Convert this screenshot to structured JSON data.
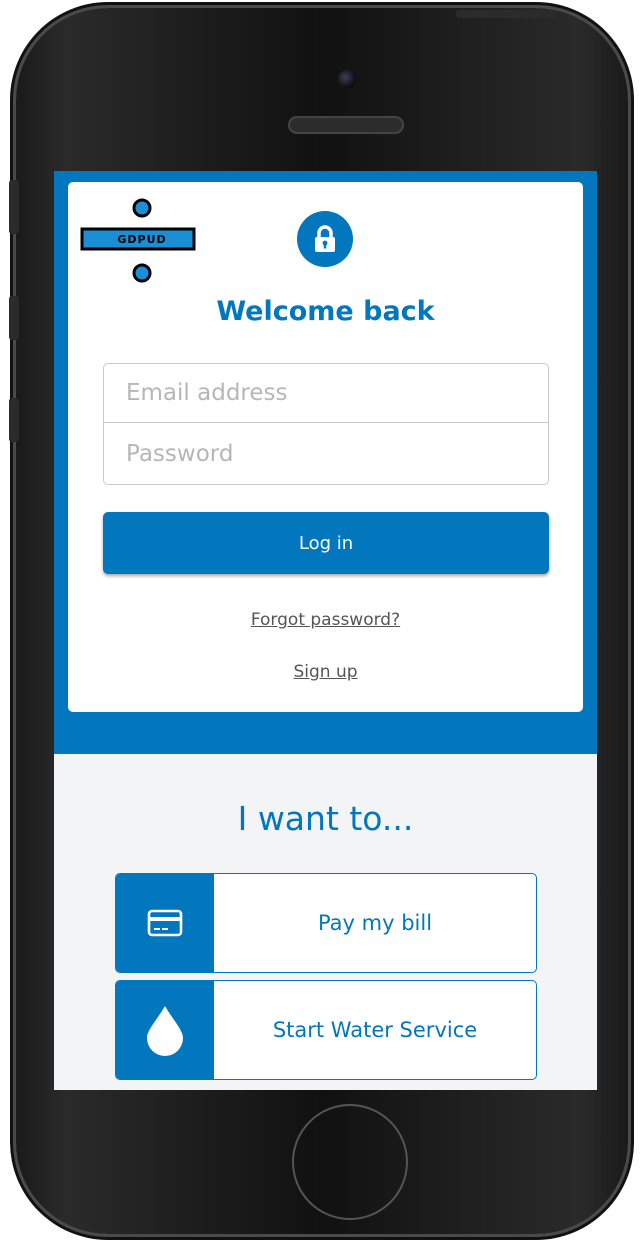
{
  "brand": {
    "logo_text": "GDPUD",
    "accent": "#0277bd"
  },
  "login": {
    "title": "Welcome back",
    "email_placeholder": "Email address",
    "password_placeholder": "Password",
    "login_label": "Log in",
    "forgot_label": "Forgot password?",
    "signup_label": "Sign up",
    "lock_icon": "lock-icon"
  },
  "actions": {
    "heading": "I want to...",
    "items": [
      {
        "label": "Pay my bill",
        "icon": "credit-card-icon"
      },
      {
        "label": "Start Water Service",
        "icon": "water-drop-icon"
      }
    ]
  }
}
